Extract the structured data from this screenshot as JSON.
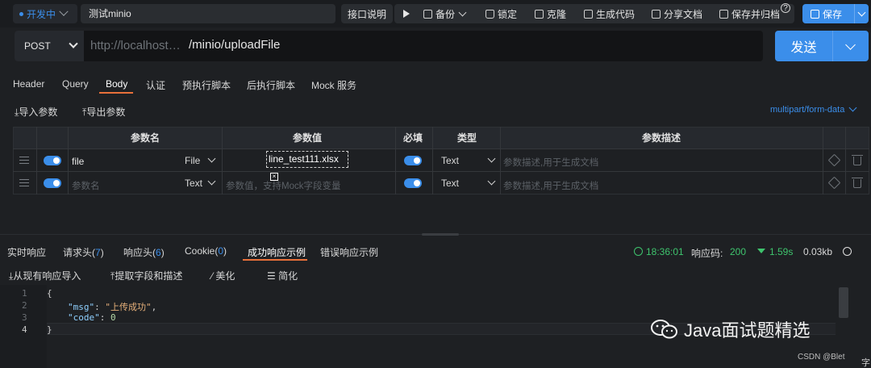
{
  "topbar": {
    "env": "开发中",
    "request_name": "测试minio",
    "doc_label": "接口说明",
    "backup_label": "备份",
    "lock_label": "锁定",
    "clone_label": "克隆",
    "gencode_label": "生成代码",
    "share_label": "分享文档",
    "save_archive_label": "保存并归档",
    "help_icon": "?",
    "save_label": "保存"
  },
  "url": {
    "method": "POST",
    "host": "http://localhost…",
    "path": "/minio/uploadFile",
    "send_label": "发送"
  },
  "tabs": [
    "Header",
    "Query",
    "Body",
    "认证",
    "预执行脚本",
    "后执行脚本",
    "Mock 服务"
  ],
  "active_tab": "Body",
  "body_actions": {
    "import": "导入参数",
    "export": "导出参数",
    "content_type": "multipart/form-data"
  },
  "table": {
    "headers": [
      "参数名",
      "参数值",
      "必填",
      "类型",
      "参数描述"
    ],
    "rows": [
      {
        "name": "file",
        "field_type": "File",
        "value": "line_test111.xlsx",
        "type": "Text",
        "desc_placeholder": "参数描述,用于生成文档"
      },
      {
        "name_placeholder": "参数名",
        "field_type": "Text",
        "value_placeholder": "参数值，支持Mock字段变量",
        "type": "Text",
        "desc_placeholder": "参数描述,用于生成文档"
      }
    ]
  },
  "response": {
    "tabs": {
      "realtime": "实时响应",
      "req_headers": "请求头",
      "req_headers_count": "7",
      "resp_headers": "响应头",
      "resp_headers_count": "6",
      "cookie": "Cookie",
      "cookie_count": "0",
      "success_example": "成功响应示例",
      "error_example": "错误响应示例"
    },
    "time": "18:36:01",
    "status_label": "响应码:",
    "status_code": "200",
    "duration": "1.59s",
    "size": "0.03kb",
    "actions": {
      "import_from_resp": "从现有响应导入",
      "extract": "提取字段和描述",
      "beautify": "美化",
      "simplify": "简化"
    },
    "code": {
      "line_numbers": [
        "1",
        "2",
        "3",
        "4"
      ],
      "open": "{",
      "msg_key": "\"msg\"",
      "msg_val": "\"上传成功\"",
      "code_key": "\"code\"",
      "code_val": "0",
      "close": "}"
    }
  },
  "watermark": {
    "text": "Java面试题精选",
    "csdn": "CSDN @Blet",
    "corner": "字"
  },
  "colors": {
    "accent": "#3b8eea",
    "tab_underline": "#e8703a",
    "success": "#3ec46d"
  }
}
